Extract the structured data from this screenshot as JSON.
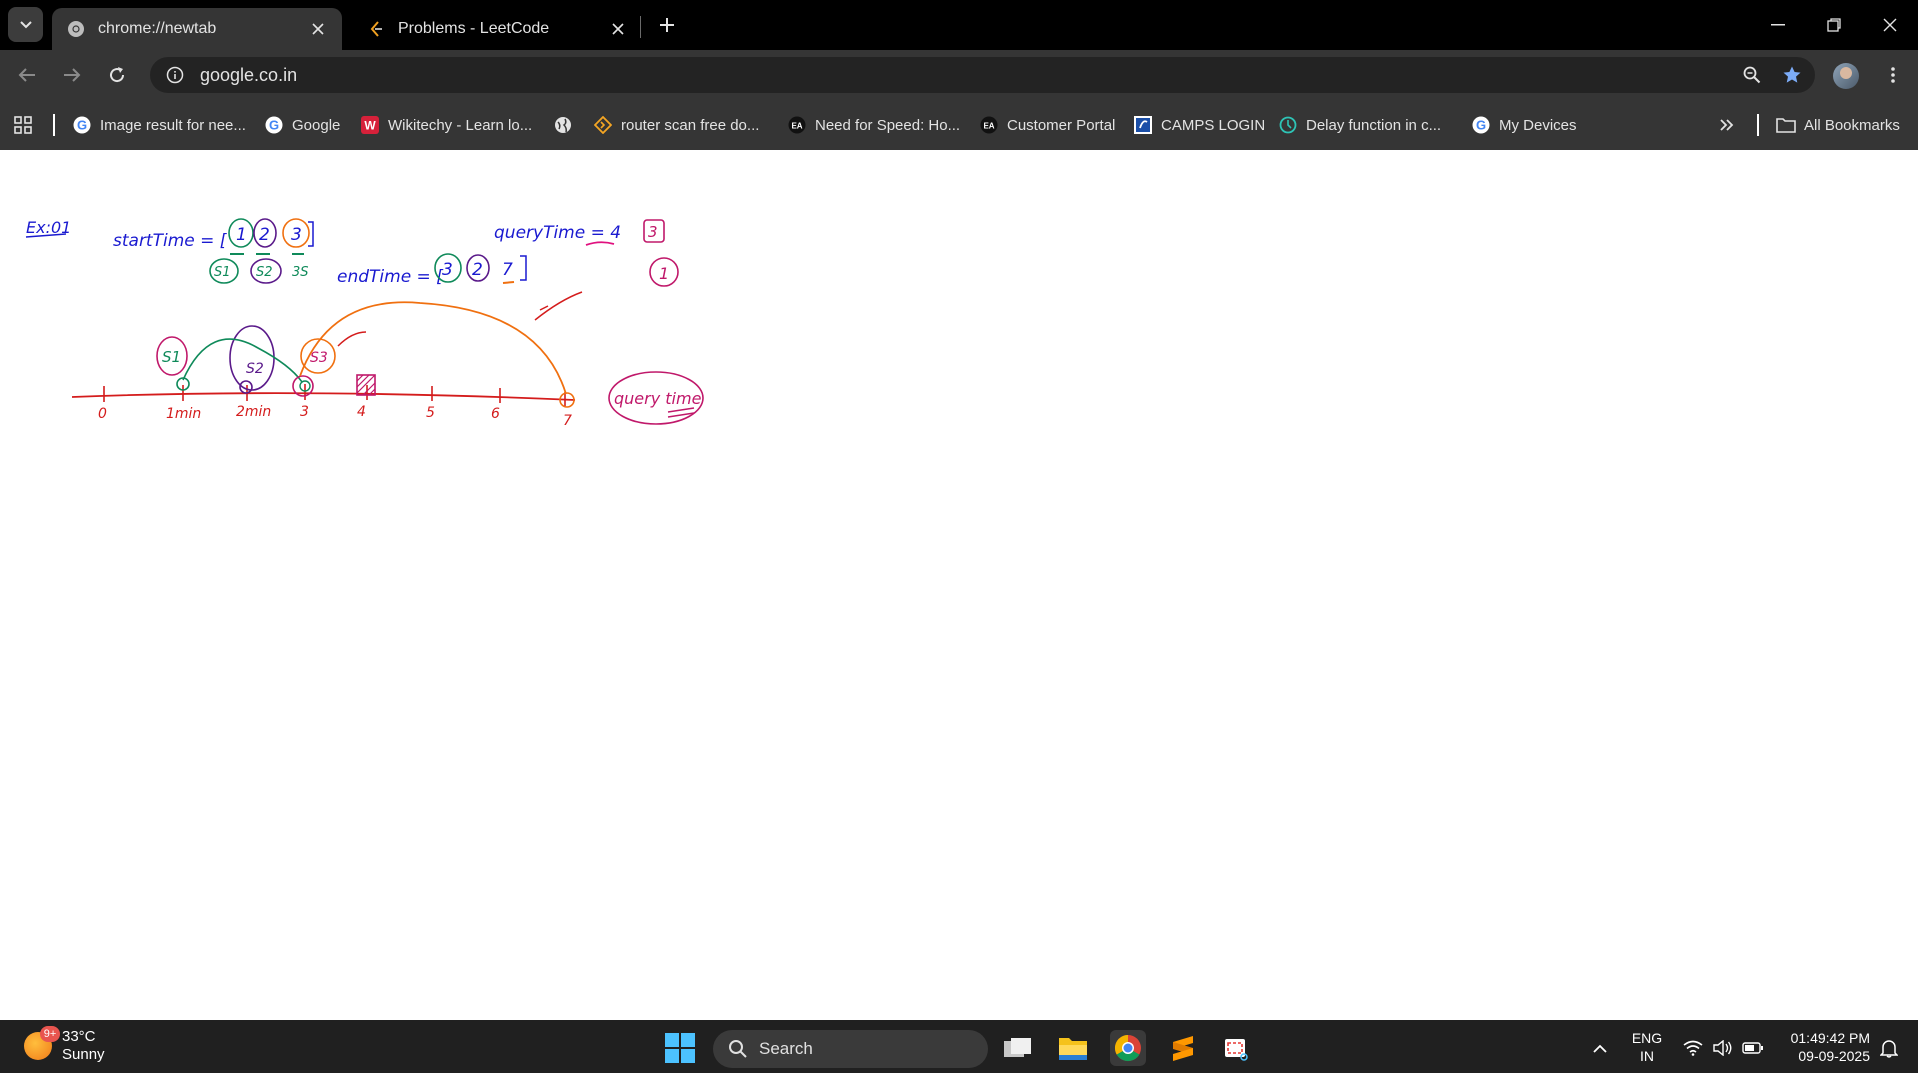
{
  "tabs": [
    {
      "title": "chrome://newtab",
      "active": true,
      "icon": "chrome-icon"
    },
    {
      "title": "Problems - LeetCode",
      "active": false,
      "icon": "leetcode-icon"
    }
  ],
  "toolbar": {
    "url": "google.co.in"
  },
  "bookmarks": [
    {
      "label": "Image result for nee...",
      "icon": "google-icon"
    },
    {
      "label": "Google",
      "icon": "google-icon"
    },
    {
      "label": "Wikitechy - Learn lo...",
      "icon": "wikitechy-icon"
    },
    {
      "label": "",
      "icon": "globe-icon"
    },
    {
      "label": "router scan free do...",
      "icon": "router-icon"
    },
    {
      "label": "Need for Speed: Ho...",
      "icon": "ea-icon"
    },
    {
      "label": "Customer Portal",
      "icon": "ea-icon"
    },
    {
      "label": "CAMPS LOGIN",
      "icon": "camps-icon"
    },
    {
      "label": "Delay function in c...",
      "icon": "delay-icon"
    },
    {
      "label": "My Devices",
      "icon": "google-icon"
    }
  ],
  "all_bookmarks_label": "All Bookmarks",
  "whiteboard": {
    "heading": "Ex:01",
    "start_time_label": "startTime = [",
    "start_values": [
      "1",
      "2",
      "3"
    ],
    "start_labels": [
      "S1",
      "S2",
      "3S"
    ],
    "end_time_label": "endTime = [",
    "end_values": [
      "3",
      "2",
      "7"
    ],
    "query_time_label": "queryTime = 4",
    "answer_values": [
      "3",
      "1"
    ],
    "axis_ticks": [
      "0",
      "1min",
      "2min",
      "3",
      "4",
      "5",
      "6",
      "7"
    ],
    "timeline_labels": [
      "S1",
      "S2",
      "S3"
    ],
    "query_bubble": "query time"
  },
  "taskbar": {
    "weather_temp": "33°C",
    "weather_desc": "Sunny",
    "weather_badge": "9+",
    "search_placeholder": "Search",
    "lang_line1": "ENG",
    "lang_line2": "IN",
    "time": "01:49:42 PM",
    "date": "09-09-2025"
  },
  "colors": {
    "ink_blue": "#1a1ad0",
    "ink_green": "#0f8a5a",
    "ink_purple": "#5a1a8a",
    "ink_red": "#d41c1c",
    "ink_orange": "#f07010",
    "ink_magenta": "#c0186a"
  }
}
